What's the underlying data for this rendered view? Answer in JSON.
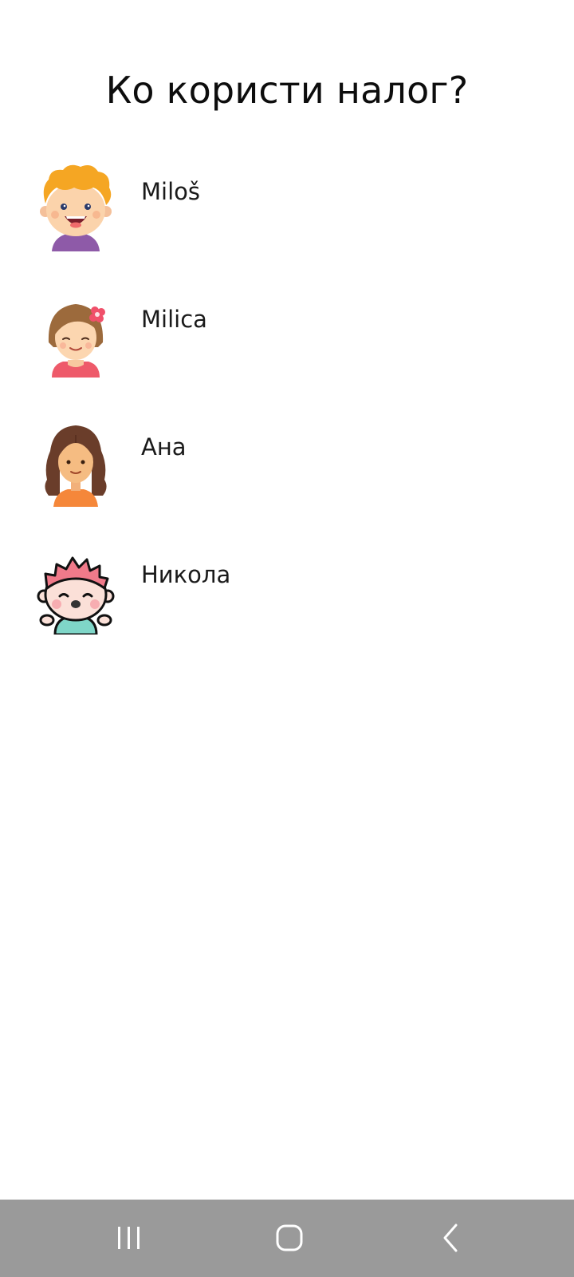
{
  "header": {
    "title": "Ко користи налог?"
  },
  "profiles": [
    {
      "name": "Miloš",
      "avatar_icon": "curly-orange-hair-boy-avatar-icon"
    },
    {
      "name": "Milica",
      "avatar_icon": "girl-with-flower-avatar-icon"
    },
    {
      "name": "Ана",
      "avatar_icon": "long-hair-girl-avatar-icon"
    },
    {
      "name": "Никола",
      "avatar_icon": "pink-hair-baby-avatar-icon"
    }
  ],
  "navigation_bar": {
    "background_color": "#9a9a9a",
    "buttons": [
      "recents-icon",
      "home-icon",
      "back-icon"
    ]
  }
}
